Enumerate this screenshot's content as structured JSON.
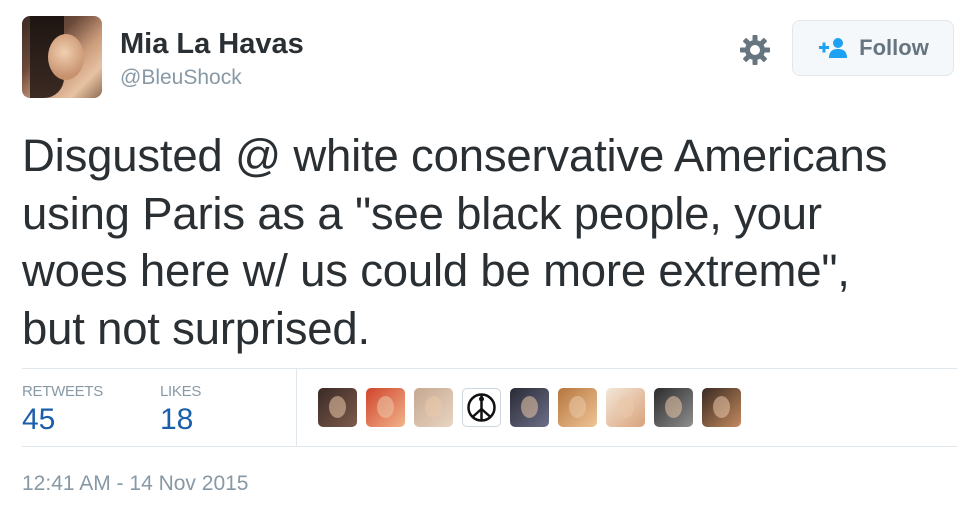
{
  "user": {
    "name": "Mia La Havas",
    "handle": "@BleuShock"
  },
  "follow_button": {
    "label": "Follow"
  },
  "tweet": {
    "lines": [
      "Disgusted @ white conservative Americans",
      "using Paris as a \"see black people, your",
      "woes here w/ us could be more extreme\",",
      "but not surprised."
    ]
  },
  "stats": {
    "retweets_label": "RETWEETS",
    "retweets_count": "45",
    "likes_label": "LIKES",
    "likes_count": "18"
  },
  "likers": [
    {
      "name": "liker-avatar-1",
      "colors": [
        "#3b2a26",
        "#7d5b4c"
      ]
    },
    {
      "name": "liker-avatar-2",
      "colors": [
        "#d0442c",
        "#f2b48a"
      ]
    },
    {
      "name": "liker-avatar-3",
      "colors": [
        "#c6a890",
        "#e8d5c2"
      ]
    },
    {
      "name": "liker-avatar-peace",
      "colors": [
        "#ffffff",
        "#ffffff"
      ],
      "icon": "peace-for-paris-icon"
    },
    {
      "name": "liker-avatar-5",
      "colors": [
        "#2a2a36",
        "#6c6f88"
      ]
    },
    {
      "name": "liker-avatar-6",
      "colors": [
        "#b5763f",
        "#f0c596"
      ]
    },
    {
      "name": "liker-avatar-7",
      "colors": [
        "#f3e7d8",
        "#d9a27b"
      ]
    },
    {
      "name": "liker-avatar-8",
      "colors": [
        "#2c2c2c",
        "#8f8f8f"
      ]
    },
    {
      "name": "liker-avatar-9",
      "colors": [
        "#3a2a22",
        "#c48a5f"
      ]
    }
  ],
  "timestamp": "12:41 AM - 14 Nov 2015",
  "colors": {
    "text": "#292f33",
    "muted": "#8899a6",
    "stat_value": "#1b5eaa",
    "follow_icon": "#1da1f2"
  }
}
